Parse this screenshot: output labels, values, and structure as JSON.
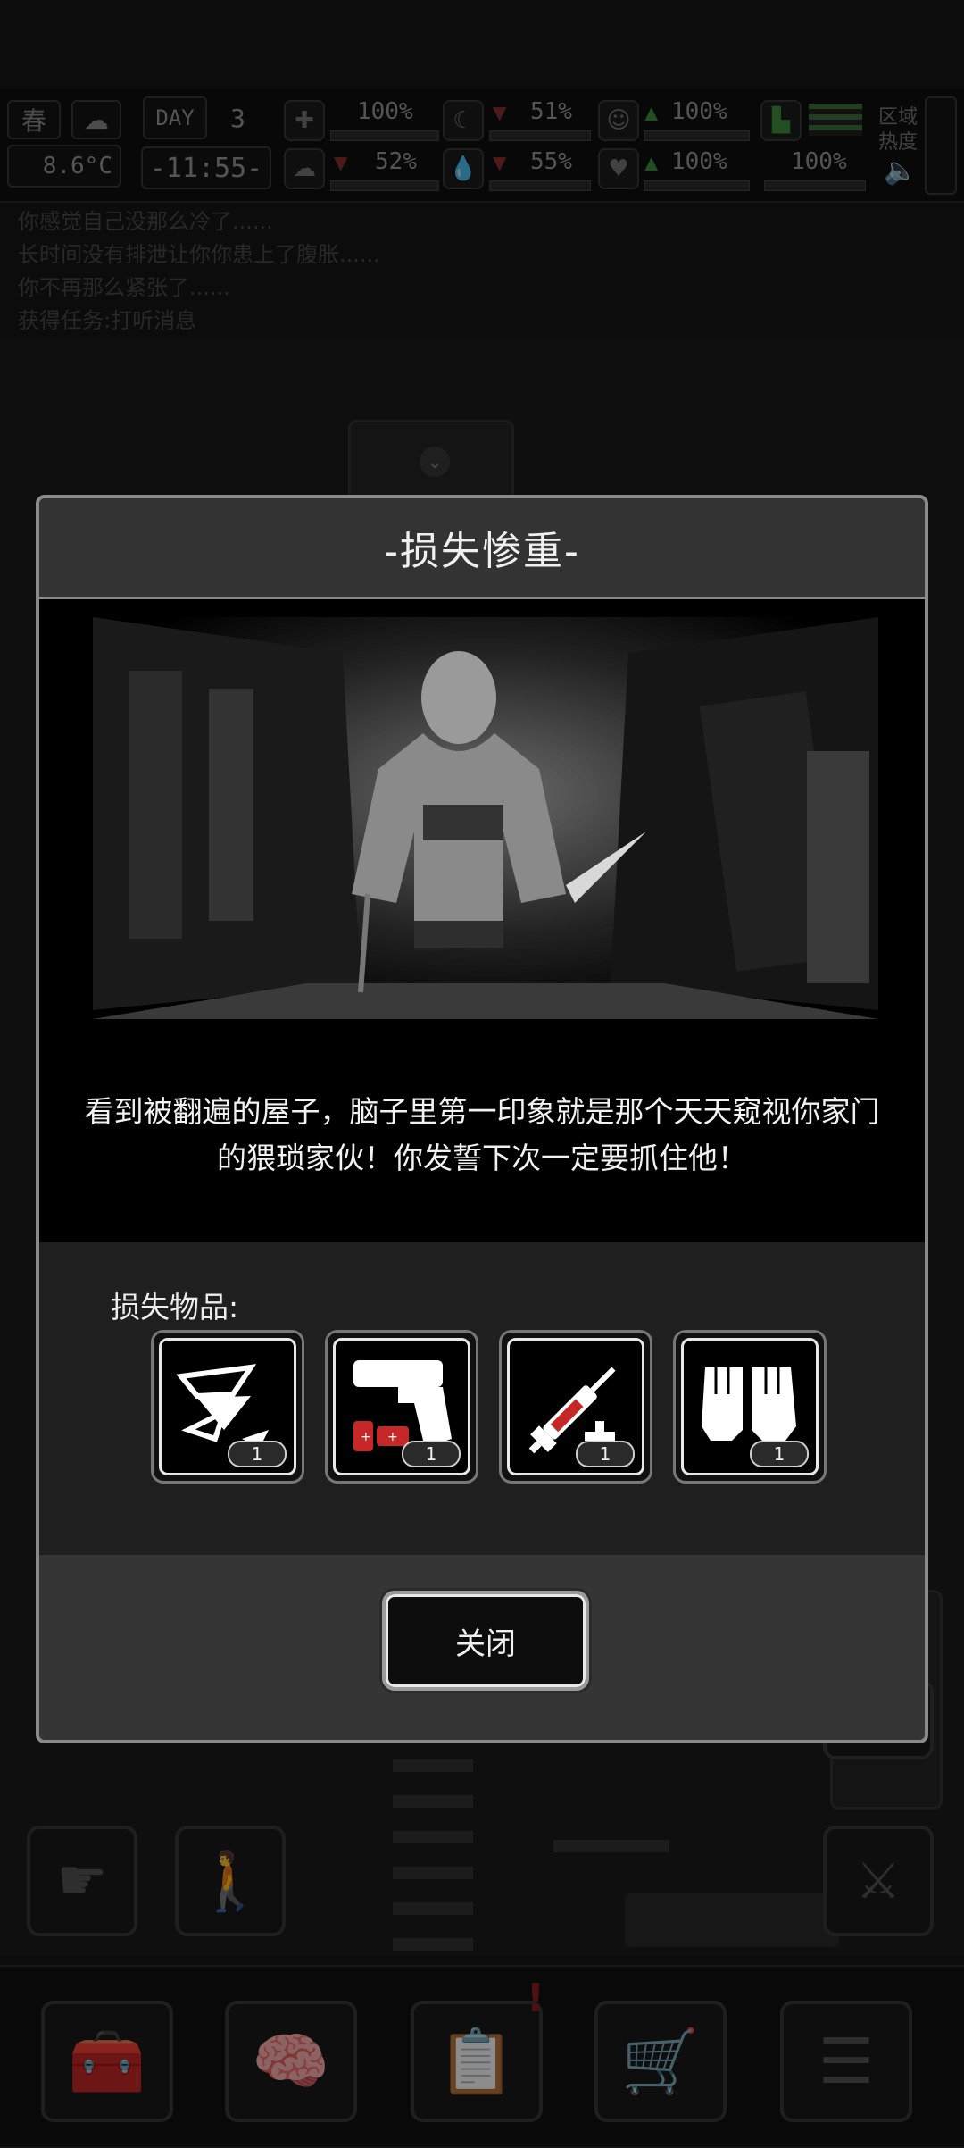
{
  "hud": {
    "season": "春",
    "temperature": "8.6°C",
    "day_label": "DAY",
    "day_number": "3",
    "clock": "-11:55-",
    "zone_heat_label": "区域热度",
    "stats": [
      {
        "name": "health",
        "percent": "100%",
        "value": 1.0
      },
      {
        "name": "hunger",
        "percent": "51%",
        "value": 0.51
      },
      {
        "name": "mood",
        "percent": "100%",
        "value": 1.0
      },
      {
        "name": "zone",
        "percent": "100%",
        "value": 1.0
      },
      {
        "name": "brain",
        "percent": "52%",
        "value": 0.52
      },
      {
        "name": "thirst",
        "percent": "55%",
        "value": 0.55
      },
      {
        "name": "heart",
        "percent": "100%",
        "value": 1.0
      }
    ]
  },
  "log": [
    "你感觉自己没那么冷了......",
    "长时间没有排泄让你你患上了腹胀......",
    "你不再那么紧张了......",
    "获得任务:打听消息"
  ],
  "dialog": {
    "title": "-损失惨重-",
    "message": "看到被翻遍的屋子，脑子里第一印象就是那个天天窥视你家门的猥琐家伙！你发誓下次一定要抓住他！",
    "lost_items_label": "损失物品:",
    "items": [
      {
        "icon": "scrap-metal-icon",
        "qty": "1"
      },
      {
        "icon": "flare-gun-icon",
        "qty": "1"
      },
      {
        "icon": "syringe-icon",
        "qty": "1"
      },
      {
        "icon": "gloves-icon",
        "qty": "1"
      }
    ],
    "close_label": "关闭"
  },
  "bottom_bar": {
    "buttons": [
      "chest-icon",
      "brain-icon",
      "notebook-icon",
      "cart-icon",
      "menu-icon"
    ]
  },
  "colors": {
    "dialog_border": "#8a8a8a",
    "text": "#f2f2f2",
    "item_red": "#c62828"
  }
}
